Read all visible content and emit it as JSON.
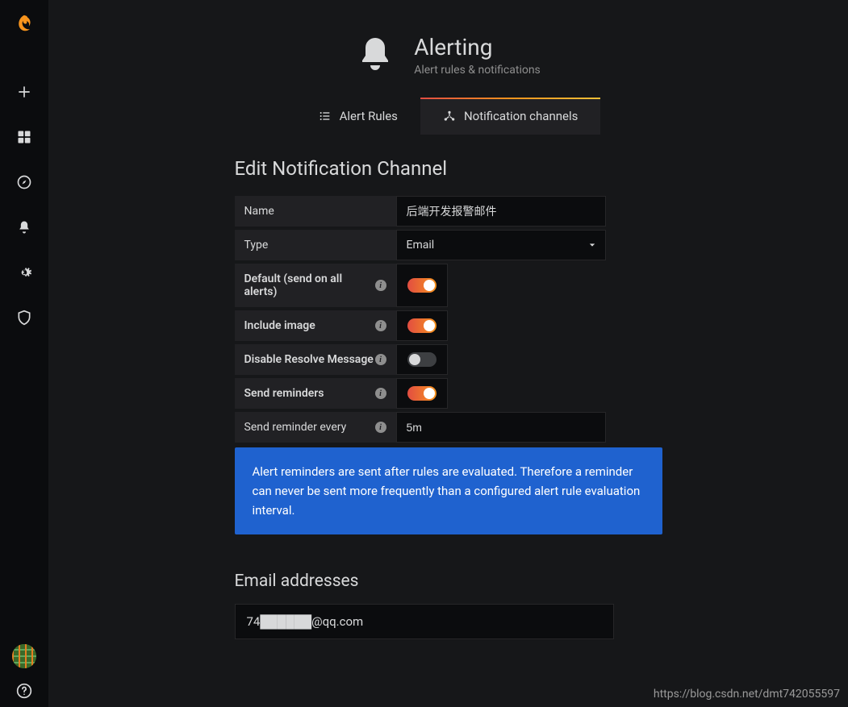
{
  "page": {
    "title": "Alerting",
    "subtitle": "Alert rules & notifications"
  },
  "tabs": {
    "rules": "Alert Rules",
    "channels": "Notification channels"
  },
  "section_title": "Edit Notification Channel",
  "form": {
    "name_label": "Name",
    "name_value": "后端开发报警邮件",
    "type_label": "Type",
    "type_value": "Email",
    "default_label": "Default (send on all alerts)",
    "default_on": true,
    "include_image_label": "Include image",
    "include_image_on": true,
    "disable_resolve_label": "Disable Resolve Message",
    "disable_resolve_on": false,
    "send_reminders_label": "Send reminders",
    "send_reminders_on": true,
    "interval_label": "Send reminder every",
    "interval_value": "5m"
  },
  "info_text": "Alert reminders are sent after rules are evaluated. Therefore a reminder can never be sent more frequently than a configured alert rule evaluation interval.",
  "emails": {
    "heading": "Email addresses",
    "value": "74██████@qq.com"
  },
  "watermark": "https://blog.csdn.net/dmt742055597"
}
